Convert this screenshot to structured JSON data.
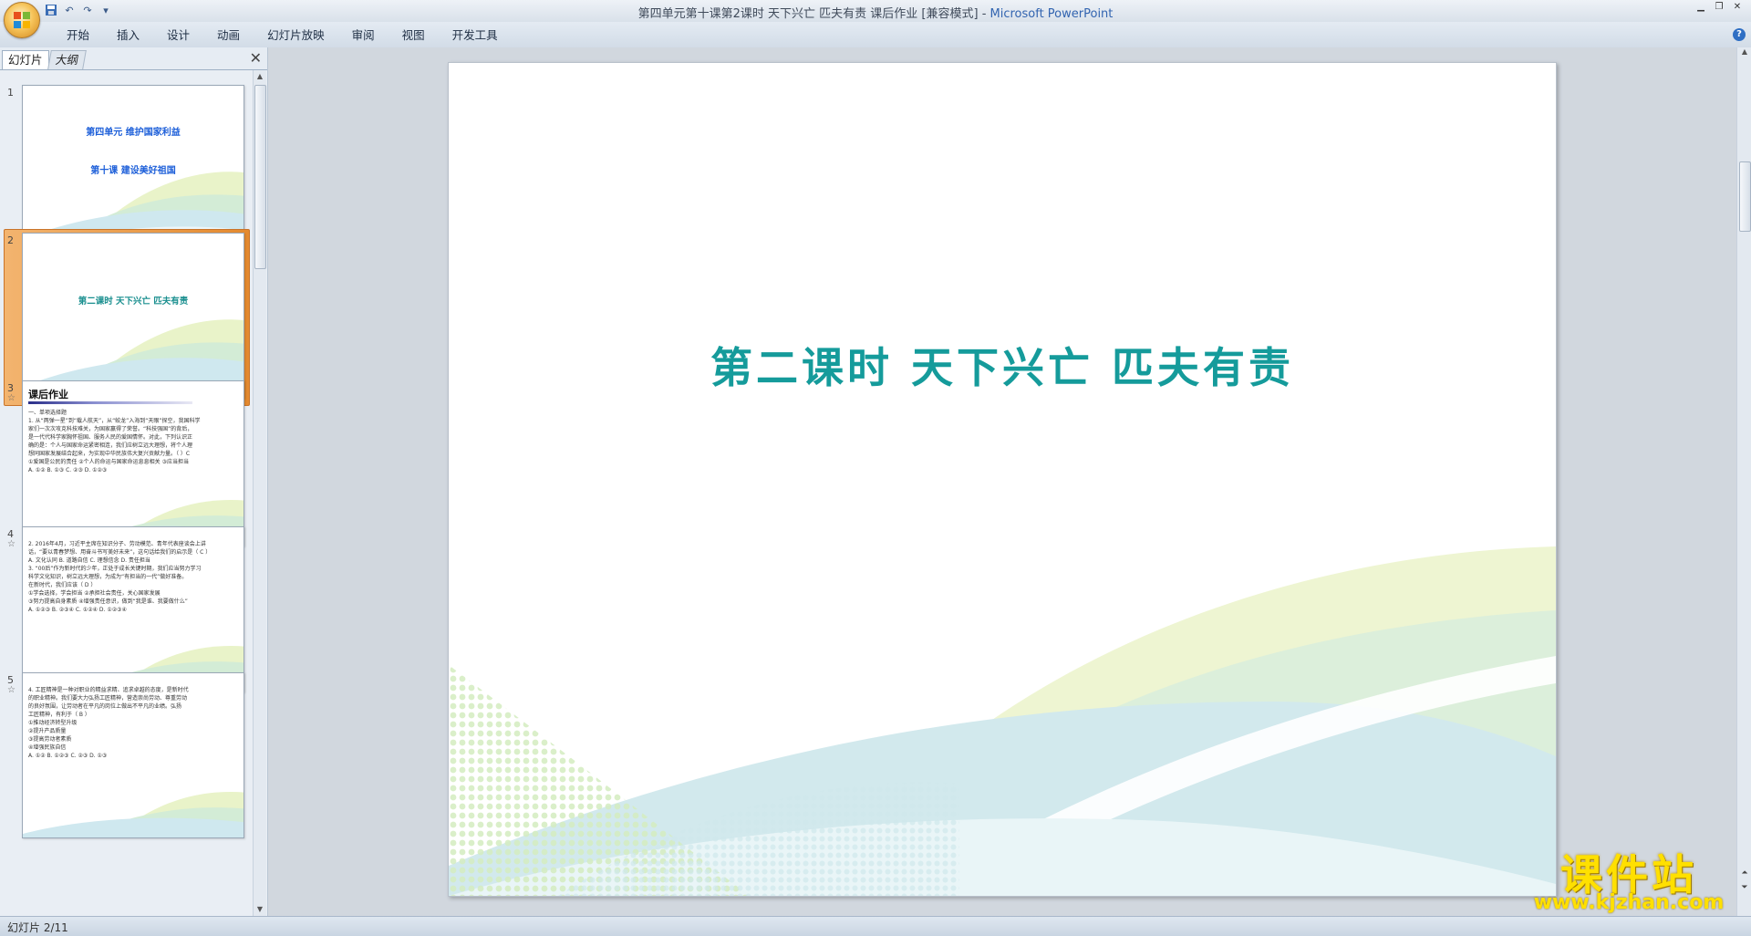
{
  "window": {
    "title": "第四单元第十课第2课时 天下兴亡 匹夫有责 课后作业 [兼容模式]",
    "app_name": "Microsoft PowerPoint"
  },
  "quick_access": {
    "save_icon": "save-icon",
    "undo_icon": "undo-icon",
    "redo_icon": "redo-icon",
    "customize_icon": "dropdown-icon"
  },
  "ribbon": {
    "tabs": [
      "开始",
      "插入",
      "设计",
      "动画",
      "幻灯片放映",
      "审阅",
      "视图",
      "开发工具"
    ]
  },
  "left_pane": {
    "tab_slides": "幻灯片",
    "tab_outline": "大纲",
    "close_glyph": "✕",
    "thumbnails": [
      {
        "num": "1",
        "title_line1": "第四单元  维护国家利益",
        "title_line2": "第十课  建设美好祖国"
      },
      {
        "num": "2",
        "center_text": "第二课时   天下兴亡 匹夫有责"
      },
      {
        "num": "3",
        "heading": "课后作业",
        "lines": [
          "一、单项选择题",
          "1. 从“两弹一星”到“载人航天”，从“蛟龙”入海到“天眼”探空，我国科学",
          "家们一次次攻克科技难关，为国家赢得了荣誉。“科技强国”的背后，",
          "是一代代科学家胸怀祖国、服务人民的爱国情怀。对此，下列认识正",
          "确的是：个人与国家命运紧密相连，我们应树立远大理想，将个人理",
          "想同国家发展结合起来，为实现中华民族伟大复兴贡献力量。（ ）C",
          "①爱国是公民的责任 ②个人的命运与国家命运息息相关 ③应当担当",
          "A. ①②   B. ①③   C. ②③   D. ①②③"
        ]
      },
      {
        "num": "4",
        "lines": [
          "2. 2016年4月，习近平主席在知识分子、劳动模范、青年代表座谈会上讲",
          "话，“要以青春梦想、用奋斗书写美好未来”，这句话给我们的启示是（ C ）",
          "A. 文化认同   B. 道路自信   C. 理想信念   D. 责任担当",
          "3. “00后”作为新时代的少年，正处于成长关键时期，我们应当努力学习",
          "科学文化知识，树立远大理想，为成为“有担当的一代”做好准备。",
          "在新时代，我们应该（ D ）",
          "①学会选择，学会担当 ②承担社会责任，关心国家发展",
          "③努力提高自身素质 ④增强责任意识，做到“我是谁、我要做什么”",
          "A. ①②③   B. ②③④   C. ①②④   D. ①②③④"
        ]
      },
      {
        "num": "5",
        "lines": [
          "4. 工匠精神是一种对职业的精益求精、追求卓越的态度，是新时代",
          "的职业精神。我们要大力弘扬工匠精神，营造崇尚劳动、尊重劳动",
          "的良好氛围，让劳动者在平凡的岗位上做出不平凡的业绩。弘扬",
          "工匠精神，有利于（ B ）",
          "①推动经济转型升级",
          "②提升产品质量",
          "③提高劳动者素质",
          "④增强民族自信",
          "A. ①②   B. ①②③   C. ②③   D. ①③"
        ]
      }
    ]
  },
  "slide": {
    "title": "第二课时    天下兴亡 匹夫有责"
  },
  "status_bar": {
    "slide_info": "幻灯片 2/11"
  },
  "watermark": {
    "text": "课件站",
    "url": "www.kjzhan.com"
  },
  "colors": {
    "title_teal": "#159b9b",
    "thumb_title_blue": "#1d5fd9",
    "selection_orange": "#e48a2f",
    "watermark_yellow": "#ffe000"
  }
}
